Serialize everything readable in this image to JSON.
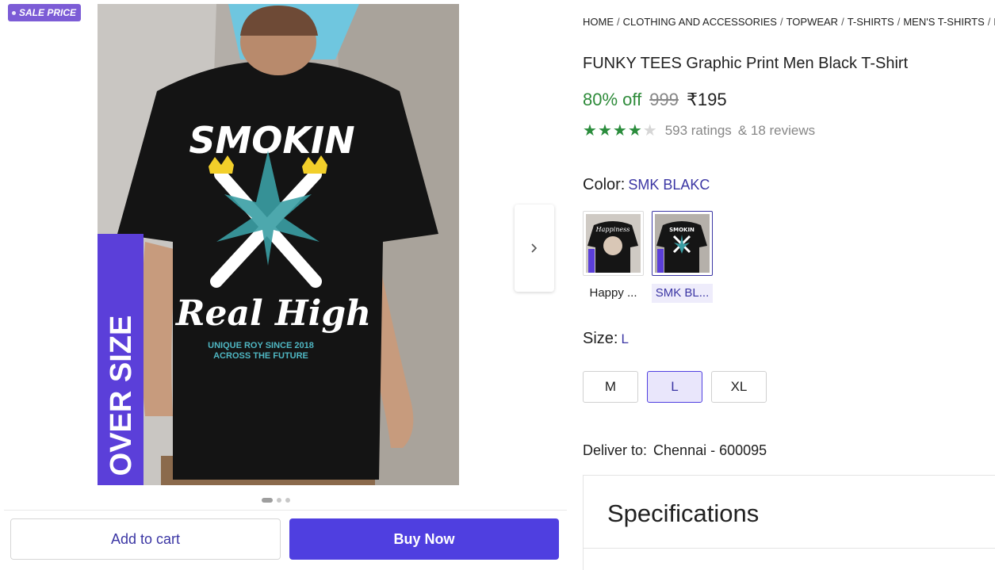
{
  "gallery": {
    "badge": "SALE PRICE",
    "image": {
      "oversize_text": "OVER SIZE",
      "print_title": "SMOKIN",
      "print_script": "Real High",
      "print_line1": "UNIQUE ROY SINCE 2018",
      "print_line2": "ACROSS THE FUTURE"
    },
    "next_icon": "chevron-right-icon",
    "dot_count": 3,
    "active_dot": 0
  },
  "actions": {
    "add_to_cart": "Add to cart",
    "buy_now": "Buy Now"
  },
  "breadcrumb": [
    "HOME",
    "CLOTHING AND ACCESSORIES",
    "TOPWEAR",
    "T-SHIRTS",
    "MEN'S T-SHIRTS",
    "FUNKY TEES T-SHIRTS"
  ],
  "product": {
    "title": "FUNKY TEES Graphic Print Men Black T-Shirt",
    "discount": "80% off",
    "mrp": "999",
    "price": "₹195",
    "rating_stars": 4,
    "ratings": "593 ratings",
    "reviews": "& 18 reviews"
  },
  "color": {
    "label": "Color:",
    "value": "SMK BLAKC",
    "options": [
      {
        "label": "Happy ...",
        "selected": false,
        "print": "Happiness"
      },
      {
        "label": "SMK BL...",
        "selected": true,
        "print": "SMOKIN"
      }
    ]
  },
  "size": {
    "label": "Size:",
    "value": "L",
    "options": [
      {
        "label": "M",
        "selected": false
      },
      {
        "label": "L",
        "selected": true
      },
      {
        "label": "XL",
        "selected": false
      }
    ]
  },
  "delivery": {
    "label": "Deliver to:",
    "location": "Chennai - 600095"
  },
  "specifications": {
    "title": "Specifications"
  },
  "colors": {
    "brand": "#4f3fe0",
    "discount_green": "#2e8b3a",
    "link_purple": "#3b36a4",
    "star_green": "#2a8c3c"
  }
}
